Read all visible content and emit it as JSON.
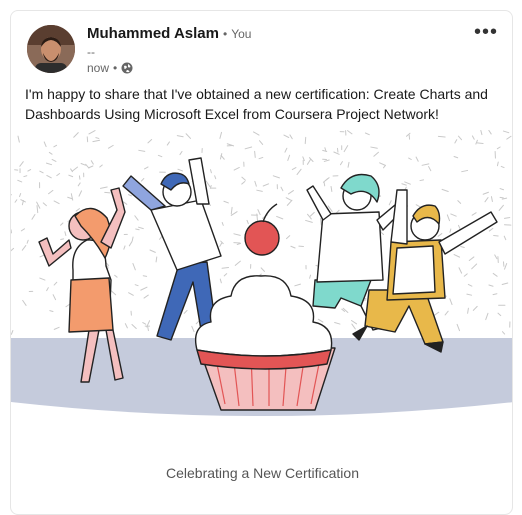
{
  "post": {
    "author_name": "Muhammed Aslam",
    "author_relation": "You",
    "separator": "•",
    "headline": "--",
    "timestamp": "now",
    "body": "I'm happy to share that I've obtained a new certification: Create Charts and Dashboards Using Microsoft Excel from Coursera Project Network!",
    "menu_label": "•••",
    "caption": "Celebrating a New Certification"
  },
  "icons": {
    "visibility": "globe-icon",
    "menu": "more-icon"
  },
  "colors": {
    "pink": "#f4bfbf",
    "red": "#e25555",
    "orange": "#f39b6d",
    "blue": "#3f68b7",
    "mint": "#7fd9cc",
    "yellow": "#e8b84a",
    "floor": "#c5cbdc"
  }
}
